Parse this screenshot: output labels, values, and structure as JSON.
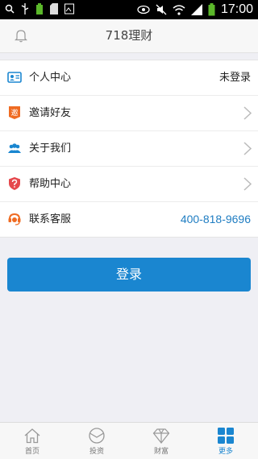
{
  "status_bar": {
    "time": "17:00"
  },
  "header": {
    "title": "718理财"
  },
  "menu": [
    {
      "label": "个人中心",
      "right": "未登录",
      "icon": "id-card-icon"
    },
    {
      "label": "邀请好友",
      "right": "",
      "icon": "invite-icon"
    },
    {
      "label": "关于我们",
      "right": "",
      "icon": "people-icon"
    },
    {
      "label": "帮助中心",
      "right": "",
      "icon": "shield-question-icon"
    },
    {
      "label": "联系客服",
      "right": "400-818-9696",
      "icon": "headset-icon"
    }
  ],
  "invite_icon_glyph": "邀",
  "login_label": "登录",
  "tabs": [
    {
      "label": "首页",
      "icon": "home-icon"
    },
    {
      "label": "投资",
      "icon": "invest-icon"
    },
    {
      "label": "财富",
      "icon": "diamond-icon"
    },
    {
      "label": "更多",
      "icon": "grid-icon",
      "active": true
    }
  ],
  "colors": {
    "accent": "#1a86d0",
    "phone": "#1f7dc2",
    "invite": "#ef6b22",
    "help": "#e5484d"
  }
}
